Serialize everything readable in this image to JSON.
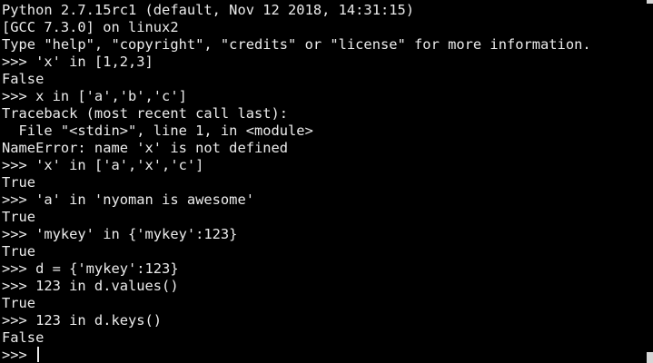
{
  "terminal": {
    "lines": [
      "Python 2.7.15rc1 (default, Nov 12 2018, 14:31:15)",
      "[GCC 7.3.0] on linux2",
      "Type \"help\", \"copyright\", \"credits\" or \"license\" for more information.",
      ">>> 'x' in [1,2,3]",
      "False",
      ">>> x in ['a','b','c']",
      "Traceback (most recent call last):",
      "  File \"<stdin>\", line 1, in <module>",
      "NameError: name 'x' is not defined",
      ">>> 'x' in ['a','x','c']",
      "True",
      ">>> 'a' in 'nyoman is awesome'",
      "True",
      ">>> 'mykey' in {'mykey':123}",
      "True",
      ">>> d = {'mykey':123}",
      ">>> 123 in d.values()",
      "True",
      ">>> 123 in d.keys()",
      "False"
    ],
    "prompt": ">>> ",
    "colors": {
      "background": "#000000",
      "foreground": "#ececec",
      "scrollbar": "#d6d6d6"
    }
  }
}
